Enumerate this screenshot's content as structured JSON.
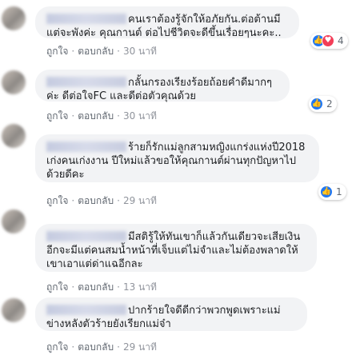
{
  "labels": {
    "like": "ถูกใจ",
    "reply": "ตอบกลับ",
    "separator": "·"
  },
  "colors": {
    "bubble": "#f2f3f5",
    "like": "#2078f4",
    "love": "#f33e58",
    "meta": "#90949c"
  },
  "comments": [
    {
      "text": "คนเราต้องรู้จักให้อภัยกัน.ต่อต้านมีแต่จะพังค่ะ คุณกานต์ ต่อไปชีวิตจะดีขึ้นเรื่อยๆนะคะ..",
      "time": "30 นาที",
      "reactions": {
        "count": "4",
        "icons": [
          "like-icon",
          "love-icon"
        ]
      }
    },
    {
      "text": "กลั้นกรองเรียงร้อยถ้อยคำดีมากๆค่ะ ดีต่อใจFC และดีต่อตัวคุณด้วย",
      "time": "30 นาที",
      "reactions": {
        "count": "2",
        "icons": [
          "like-icon"
        ]
      }
    },
    {
      "text": "ร้ายก็รักแม่ลูกสามหญิงแกร่งแห่งปี2018 เก่งคนเก่งงาน ปีใหม่แล้วขอให้คุณกานต์ผ่านทุกปัญหาไปด้วยดีคะ",
      "time": "29 นาที",
      "reactions": {
        "count": "1",
        "icons": [
          "like-icon"
        ]
      }
    },
    {
      "text": "มีสติรู้ให้ทันเขาก็แล้วกันเดียวจะเสียเงินอีกจะมีแต่คนสมน้ำหน้าที่เจ็บแต่ไม่จำและไม่ต้องพลาดให้เขาเอาแต่ด่าแฉอีกละ",
      "time": "13 นาที"
    },
    {
      "text": "ปากร้ายใจดีดีกว่าพวกพูดเพราะแม่ข่างหลังตัวร้ายยังเรียกแม่จ๋า",
      "time": "29 นาที"
    }
  ]
}
